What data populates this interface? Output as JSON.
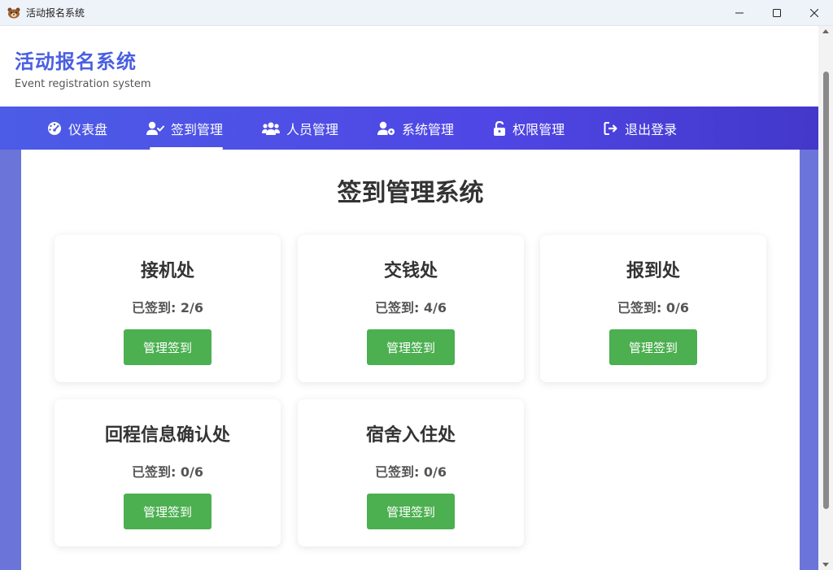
{
  "window": {
    "title": "活动报名系统",
    "app_icon": "bear-face-icon"
  },
  "header": {
    "title": "活动报名系统",
    "subtitle": "Event registration system"
  },
  "nav": {
    "items": [
      {
        "label": "仪表盘",
        "icon": "dashboard-gauge-icon"
      },
      {
        "label": "签到管理",
        "icon": "user-check-icon",
        "active": true
      },
      {
        "label": "人员管理",
        "icon": "users-icon"
      },
      {
        "label": "系统管理",
        "icon": "user-gear-icon"
      },
      {
        "label": "权限管理",
        "icon": "unlock-icon"
      },
      {
        "label": "退出登录",
        "icon": "sign-out-icon"
      }
    ]
  },
  "main": {
    "title": "签到管理系统",
    "cards": [
      {
        "name": "接机处",
        "status": "已签到: 2/6",
        "button": "管理签到"
      },
      {
        "name": "交钱处",
        "status": "已签到: 4/6",
        "button": "管理签到"
      },
      {
        "name": "报到处",
        "status": "已签到: 0/6",
        "button": "管理签到"
      },
      {
        "name": "回程信息确认处",
        "status": "已签到: 0/6",
        "button": "管理签到"
      },
      {
        "name": "宿舍入住处",
        "status": "已签到: 0/6",
        "button": "管理签到"
      }
    ]
  },
  "colors": {
    "accent": "#4a5fe0",
    "nav_gradient_start": "#4c5ce6",
    "nav_gradient_end": "#4338ca",
    "button_green": "#4caf50",
    "page_background": "#6b74d9"
  }
}
